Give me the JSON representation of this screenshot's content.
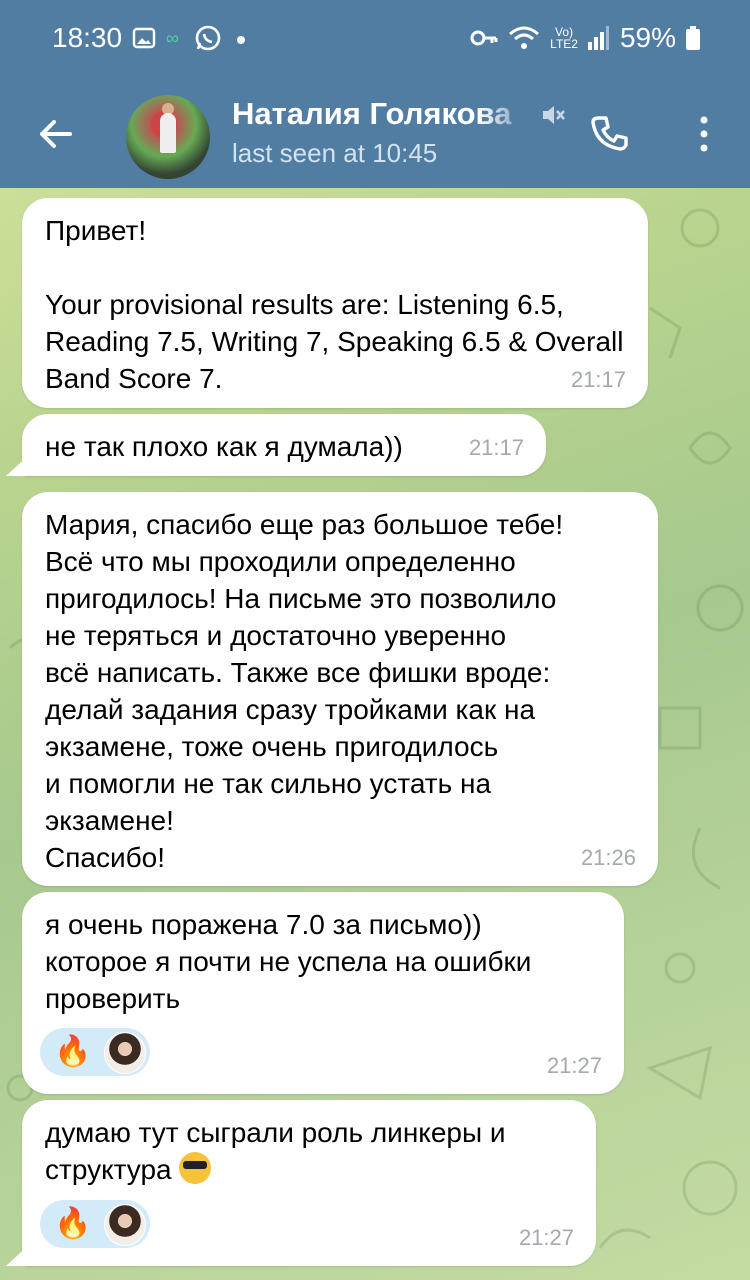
{
  "status_bar": {
    "time": "18:30",
    "battery": "59%"
  },
  "header": {
    "contact_name": "Наталия Голякова",
    "last_seen": "last seen at 10:45"
  },
  "messages": [
    {
      "text": "Привет!\n\nYour provisional results are: Listening 6.5, Reading 7.5, Writing 7, Speaking 6.5 & Overall Band Score 7.",
      "time": "21:17"
    },
    {
      "text": "не так плохо как я думала))",
      "time": "21:17"
    },
    {
      "text": "Мария, спасибо еще раз большое тебе!\nВсё что мы проходили определенно\nпригодилось! На письме это позволило\nне теряться и достаточно уверенно\nвсё написать. Также все фишки вроде:\nделай задания сразу тройками как на\nэкзамене, тоже очень пригодилось\nи помогли не так сильно устать на\nэкзамене!\nСпасибо!",
      "time": "21:26"
    },
    {
      "text": "я очень поражена 7.0 за письмо))\nкоторое я почти не успела на ошибки\nпроверить",
      "time": "21:27",
      "reaction": "🔥"
    },
    {
      "text": "думаю тут сыграли роль линкеры и\nструктура",
      "emoji": "sunglasses",
      "time": "21:27",
      "reaction": "🔥"
    }
  ],
  "colors": {
    "header": "#527da3",
    "bubble": "#ffffff",
    "reaction_pill": "#d3ebf8",
    "timestamp": "#a3a9ae"
  },
  "icons": [
    "back-arrow-icon",
    "mute-icon",
    "phone-icon",
    "more-vert-icon",
    "gallery-icon",
    "whatsapp-icon",
    "key-icon",
    "wifi-icon",
    "signal-icon",
    "battery-icon"
  ]
}
